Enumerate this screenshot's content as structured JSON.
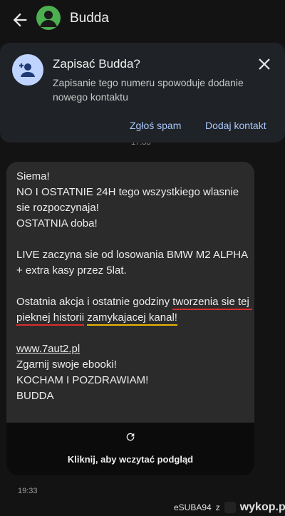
{
  "header": {
    "contact_name": "Budda",
    "icons": {
      "back": "back-arrow-icon",
      "avatar": "person-avatar-icon"
    }
  },
  "save_banner": {
    "title": "Zapisać Budda?",
    "description": "Zapisanie tego numeru spowoduje dodanie nowego kontaktu",
    "report_spam_label": "Zgłoś spam",
    "add_contact_label": "Dodaj kontakt",
    "icons": {
      "add_person": "add-person-icon",
      "close": "close-icon"
    }
  },
  "partial_timestamp": "17:33",
  "message": {
    "lines": [
      "Siema!",
      "NO I OSTATNIE 24H tego wszystkiego wlasnie sie rozpoczynaja!",
      "OSTATNIA doba!",
      "",
      "LIVE zaczyna sie od losowania BMW M2 ALPHA + extra kasy przez 5lat.",
      ""
    ],
    "para_a_prefix": "Ostatnia akcja i ostatnie godziny ",
    "para_a_red": "tworzenia sie tej pieknej historii",
    "para_a_space": " ",
    "para_a_yellow": "zamykajacej kanal!",
    "link": "www.7aut2.pl",
    "closing": [
      "Zgarnij swoje ebooki!",
      "KOCHAM I POZDRAWIAM!",
      "BUDDA"
    ],
    "preview_label": "Kliknij, aby wczytać podgląd",
    "timestamp": "19:33"
  },
  "watermark": {
    "user": "eSUBA94",
    "separator": "z",
    "site": "wykop.pl"
  },
  "colors": {
    "background": "#131313",
    "banner": "#1f2226",
    "bubble": "#2b2b2b",
    "accent_link": "#a8c7fa",
    "avatar": "#4caf50",
    "underline_red": "#d92d2d",
    "underline_yellow": "#e8b400"
  }
}
